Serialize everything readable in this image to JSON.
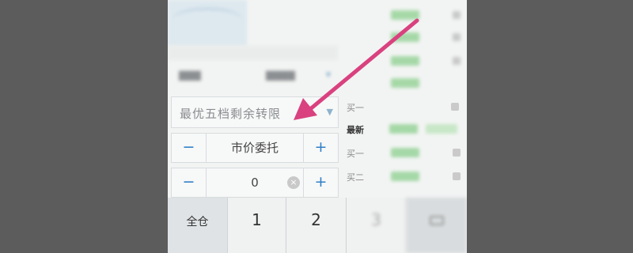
{
  "form": {
    "price_type_selected": "最优五档剩余转限",
    "price_label": "市价委托",
    "quantity_value": "0",
    "minus_symbol": "−",
    "plus_symbol": "+",
    "clear_symbol": "×",
    "dropdown_symbol": "▼"
  },
  "orderbook": {
    "labels": [
      "买一",
      "最新",
      "买一",
      "买二"
    ]
  },
  "keypad": {
    "keys": [
      "全仓",
      "1",
      "2",
      "3"
    ]
  },
  "colors": {
    "arrow": "#d9417f",
    "accent_blue": "#2f7fc6",
    "bid_green": "#8ccf8e"
  },
  "icons": [
    "minus-icon",
    "plus-icon",
    "clear-icon",
    "dropdown-icon",
    "backspace-icon",
    "arrow-annotation"
  ]
}
